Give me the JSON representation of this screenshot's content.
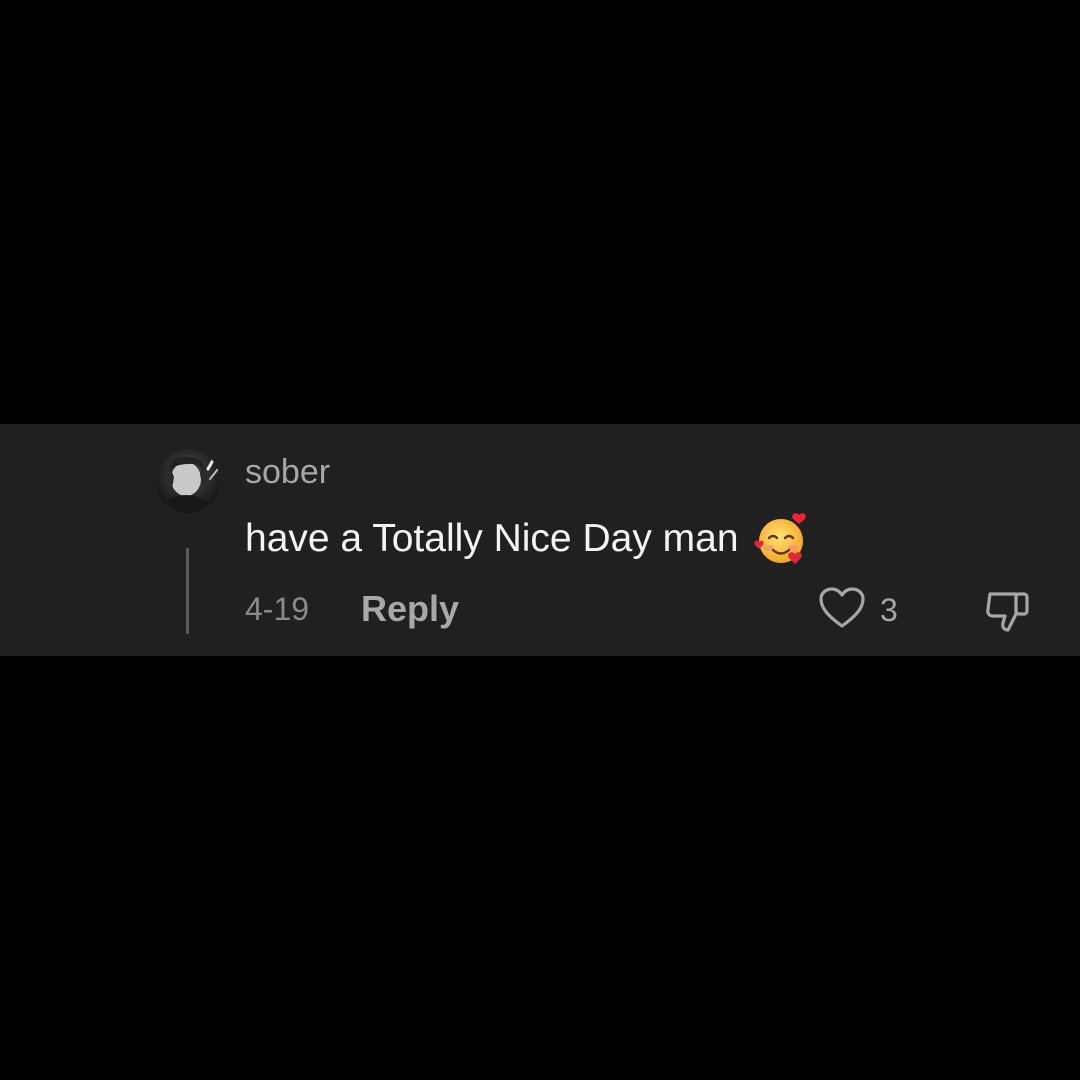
{
  "comment": {
    "username": "sober",
    "text": "have a Totally Nice Day man",
    "emoji": "smiling-face-with-hearts",
    "timestamp": "4-19",
    "reply_label": "Reply",
    "like_count": "3",
    "icons": {
      "avatar": "user-avatar",
      "like": "heart-outline-icon",
      "dislike": "thumbs-down-outline-icon"
    }
  },
  "colors": {
    "page_background": "#000000",
    "band_background": "#202020",
    "primary_text": "#f4f4f4",
    "secondary_text": "#a6a6a6"
  }
}
